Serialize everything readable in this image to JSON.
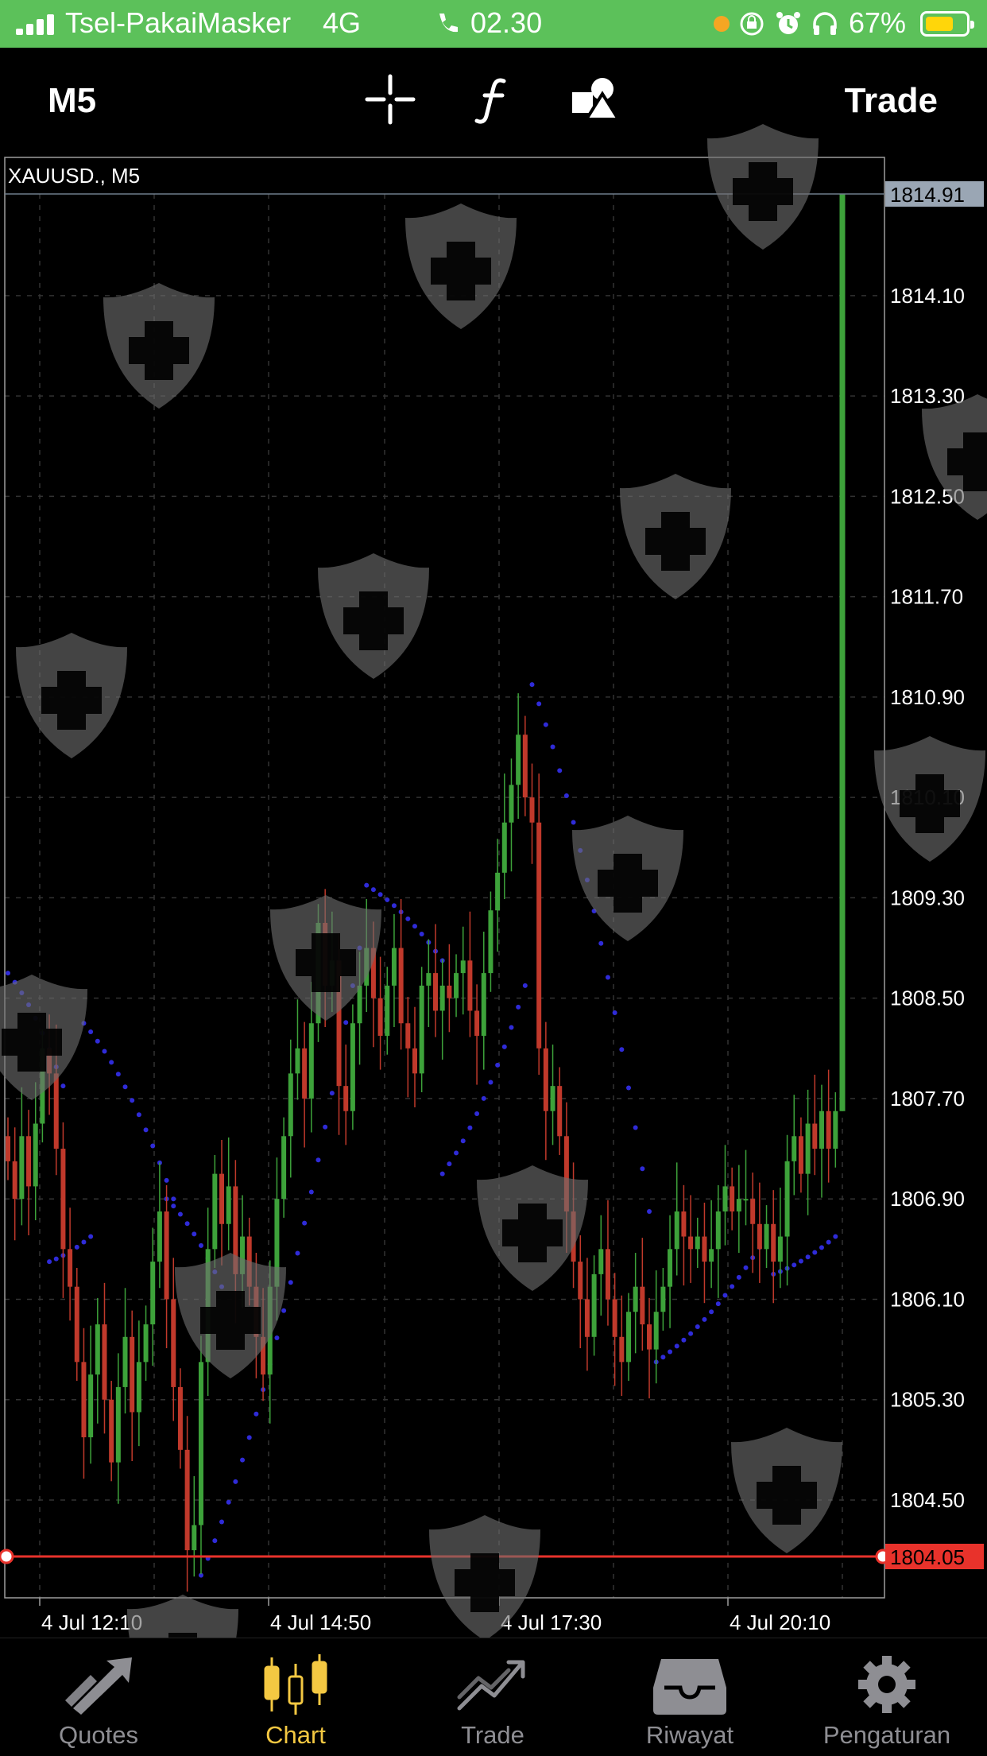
{
  "status_bar": {
    "carrier": "Tsel-PakaiMasker",
    "network": "4G",
    "time": "02.30",
    "battery": "67%",
    "battery_level": 0.67,
    "background_color": "#5cc15a",
    "icons": [
      "signal-icon",
      "call-icon",
      "orange-dot-icon",
      "rotation-lock-icon",
      "alarm-icon",
      "headphones-icon",
      "battery-icon"
    ]
  },
  "toolbar": {
    "timeframe": "M5",
    "crosshair_icon": "crosshair-icon",
    "indicator_icon": "function-icon",
    "objects_icon": "shapes-icon",
    "trade_label": "Trade"
  },
  "chart": {
    "symbol_label": "XAUUSD., M5",
    "current_price": "1814.91",
    "sell_line_price": "1804.05",
    "colors": {
      "bull": "#3da23a",
      "bear": "#c0392b",
      "sar": "#2f2bd8",
      "price_line": "#e8322b",
      "grid": "#333333",
      "current_price_bg": "#9aa6b4"
    }
  },
  "chart_data": {
    "type": "candlestick",
    "title": "XAUUSD., M5",
    "y_ticks": [
      "1814.10",
      "1813.30",
      "1812.50",
      "1811.70",
      "1810.90",
      "1810.10",
      "1809.30",
      "1808.50",
      "1807.70",
      "1806.90",
      "1806.10",
      "1805.30",
      "1804.50"
    ],
    "x_ticks": [
      "4 Jul 12:10",
      "4 Jul 14:50",
      "4 Jul 17:30",
      "4 Jul 20:10"
    ],
    "ylim": [
      1803.7,
      1815.1
    ],
    "price_labels": [
      "1814.91",
      "1804.05"
    ],
    "grid": true,
    "indicator": "Parabolic SAR",
    "close_series": [
      1807.2,
      1806.9,
      1807.4,
      1807.0,
      1807.5,
      1808.1,
      1807.9,
      1807.3,
      1806.5,
      1806.2,
      1805.6,
      1805.0,
      1805.5,
      1805.9,
      1805.3,
      1804.8,
      1805.4,
      1805.8,
      1805.2,
      1805.6,
      1805.9,
      1806.4,
      1806.8,
      1806.1,
      1805.4,
      1804.9,
      1804.1,
      1804.3,
      1805.6,
      1806.5,
      1807.1,
      1806.7,
      1807.0,
      1806.3,
      1806.6,
      1806.2,
      1805.8,
      1805.5,
      1806.2,
      1806.9,
      1807.4,
      1807.9,
      1808.1,
      1807.7,
      1808.3,
      1809.1,
      1808.6,
      1808.8,
      1807.8,
      1807.6,
      1808.3,
      1808.6,
      1808.9,
      1808.5,
      1808.2,
      1808.6,
      1808.9,
      1808.3,
      1808.1,
      1807.9,
      1808.6,
      1808.7,
      1808.4,
      1808.6,
      1808.5,
      1808.7,
      1808.8,
      1808.4,
      1808.2,
      1808.7,
      1809.2,
      1809.5,
      1809.9,
      1810.2,
      1810.6,
      1810.1,
      1809.9,
      1808.1,
      1807.6,
      1807.8,
      1807.4,
      1806.8,
      1806.4,
      1806.1,
      1805.8,
      1806.3,
      1806.5,
      1806.1,
      1805.8,
      1805.6,
      1806.0,
      1806.2,
      1805.9,
      1805.7,
      1806.0,
      1806.2,
      1806.5,
      1806.8,
      1806.6,
      1806.5,
      1806.6,
      1806.4,
      1806.5,
      1806.8,
      1807.0,
      1806.8,
      1806.9,
      1806.9,
      1806.7,
      1806.5,
      1806.7,
      1806.4,
      1806.6,
      1807.2,
      1807.4,
      1807.1,
      1807.5,
      1807.3,
      1807.6,
      1807.3,
      1807.6,
      1814.91
    ],
    "sar_series": [
      {
        "from": 0,
        "to": 8,
        "start": 1808.7,
        "end": 1807.8
      },
      {
        "from": 6,
        "to": 12,
        "start": 1806.4,
        "end": 1806.6
      },
      {
        "from": 11,
        "to": 24,
        "start": 1808.3,
        "end": 1806.9
      },
      {
        "from": 23,
        "to": 31,
        "start": 1806.9,
        "end": 1806.2
      },
      {
        "from": 28,
        "to": 51,
        "start": 1803.9,
        "end": 1808.9
      },
      {
        "from": 52,
        "to": 63,
        "start": 1809.4,
        "end": 1808.8
      },
      {
        "from": 63,
        "to": 75,
        "start": 1807.1,
        "end": 1808.6
      },
      {
        "from": 76,
        "to": 93,
        "start": 1811.0,
        "end": 1806.8
      },
      {
        "from": 94,
        "to": 110,
        "start": 1805.6,
        "end": 1806.6
      },
      {
        "from": 111,
        "to": 120,
        "start": 1806.3,
        "end": 1806.6
      }
    ]
  },
  "bottom_nav": {
    "items": [
      {
        "label": "Quotes",
        "icon": "quotes-arrows-icon",
        "active": false
      },
      {
        "label": "Chart",
        "icon": "candlestick-icon",
        "active": true
      },
      {
        "label": "Trade",
        "icon": "trade-chart-icon",
        "active": false
      },
      {
        "label": "Riwayat",
        "icon": "inbox-tray-icon",
        "active": false
      },
      {
        "label": "Pengaturan",
        "icon": "gear-icon",
        "active": false
      }
    ],
    "active_color": "#f4c842",
    "inactive_color": "#8e8e93"
  }
}
